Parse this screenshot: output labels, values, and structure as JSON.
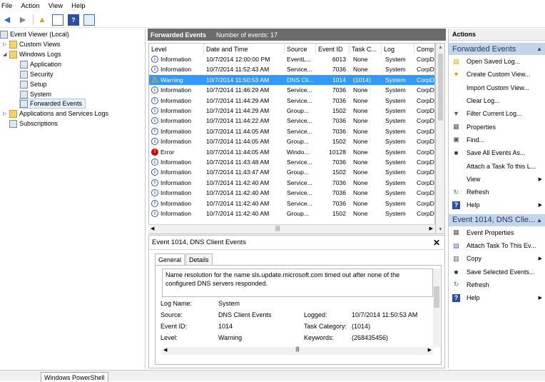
{
  "menu": [
    "File",
    "Action",
    "View",
    "Help"
  ],
  "toolbar": {
    "icons": [
      "back-arrow-icon",
      "forward-arrow-icon",
      "show-hide-tree-icon",
      "up-folder-icon",
      "properties-icon",
      "help-icon",
      "show-hide-action-icon"
    ]
  },
  "tree": {
    "root": "Event Viewer (Local)",
    "custom_views": "Custom Views",
    "windows_logs": "Windows Logs",
    "application": "Application",
    "security": "Security",
    "setup": "Setup",
    "system": "System",
    "forwarded_events": "Forwarded Events",
    "app_services": "Applications and Services Logs",
    "subscriptions": "Subscriptions"
  },
  "center": {
    "title": "Forwarded Events",
    "count": "Number of events: 17",
    "columns": [
      "Level",
      "Date and Time",
      "Source",
      "Event ID",
      "Task C...",
      "Log",
      "Comp"
    ],
    "rows": [
      {
        "level": "Information",
        "date": "10/7/2014 12:00:00 PM",
        "source": "EventL...",
        "id": "6013",
        "task": "None",
        "log": "System",
        "comp": "CorpD"
      },
      {
        "level": "Information",
        "date": "10/7/2014 11:52:43 AM",
        "source": "Service...",
        "id": "7036",
        "task": "None",
        "log": "System",
        "comp": "CorpD"
      },
      {
        "level": "Warning",
        "date": "10/7/2014 11:50:53 AM",
        "source": "DNS Cli...",
        "id": "1014",
        "task": "(1014)",
        "log": "System",
        "comp": "CorpD"
      },
      {
        "level": "Information",
        "date": "10/7/2014 11:46:29 AM",
        "source": "Service...",
        "id": "7036",
        "task": "None",
        "log": "System",
        "comp": "CorpD"
      },
      {
        "level": "Information",
        "date": "10/7/2014 11:44:29 AM",
        "source": "Service...",
        "id": "7036",
        "task": "None",
        "log": "System",
        "comp": "CorpD"
      },
      {
        "level": "Information",
        "date": "10/7/2014 11:44:29 AM",
        "source": "Group...",
        "id": "1502",
        "task": "None",
        "log": "System",
        "comp": "CorpD"
      },
      {
        "level": "Information",
        "date": "10/7/2014 11:44:22 AM",
        "source": "Service...",
        "id": "7036",
        "task": "None",
        "log": "System",
        "comp": "CorpD"
      },
      {
        "level": "Information",
        "date": "10/7/2014 11:44:05 AM",
        "source": "Service...",
        "id": "7036",
        "task": "None",
        "log": "System",
        "comp": "CorpD"
      },
      {
        "level": "Information",
        "date": "10/7/2014 11:44:05 AM",
        "source": "Group...",
        "id": "1502",
        "task": "None",
        "log": "System",
        "comp": "CorpD"
      },
      {
        "level": "Error",
        "date": "10/7/2014 11:44:05 AM",
        "source": "Windo...",
        "id": "10128",
        "task": "None",
        "log": "System",
        "comp": "CorpD"
      },
      {
        "level": "Information",
        "date": "10/7/2014 11:43:48 AM",
        "source": "Service...",
        "id": "7036",
        "task": "None",
        "log": "System",
        "comp": "CorpD"
      },
      {
        "level": "Information",
        "date": "10/7/2014 11:43:47 AM",
        "source": "Group...",
        "id": "1502",
        "task": "None",
        "log": "System",
        "comp": "CorpD"
      },
      {
        "level": "Information",
        "date": "10/7/2014 11:42:40 AM",
        "source": "Service...",
        "id": "7036",
        "task": "None",
        "log": "System",
        "comp": "CorpD"
      },
      {
        "level": "Information",
        "date": "10/7/2014 11:42:40 AM",
        "source": "Service...",
        "id": "7036",
        "task": "None",
        "log": "System",
        "comp": "CorpD"
      },
      {
        "level": "Information",
        "date": "10/7/2014 11:42:40 AM",
        "source": "Service...",
        "id": "7036",
        "task": "None",
        "log": "System",
        "comp": "CorpD"
      },
      {
        "level": "Information",
        "date": "10/7/2014 11:42:40 AM",
        "source": "Group...",
        "id": "1502",
        "task": "None",
        "log": "System",
        "comp": "CorpD"
      }
    ]
  },
  "detail": {
    "title": "Event 1014, DNS Client Events",
    "tabs": [
      "General",
      "Details"
    ],
    "message": "Name resolution for the name sls.update.microsoft.com timed out after none of the configured DNS servers responded.",
    "log_name_label": "Log Name:",
    "log_name": "System",
    "source_label": "Source:",
    "source": "DNS Client Events",
    "logged_label": "Logged:",
    "logged": "10/7/2014 11:50:53 AM",
    "event_id_label": "Event ID:",
    "event_id": "1014",
    "task_cat_label": "Task Category:",
    "task_cat": "(1014)",
    "level_label": "Level:",
    "level": "Warning",
    "keywords_label": "Keywords:",
    "keywords": "(268435456)"
  },
  "actions": {
    "title": "Actions",
    "section1": "Forwarded Events",
    "items1": [
      {
        "label": "Open Saved Log...",
        "icon": "folder-open-icon",
        "sub": false
      },
      {
        "label": "Create Custom View...",
        "icon": "filter-create-icon",
        "sub": false
      },
      {
        "label": "Import Custom View...",
        "icon": "none",
        "sub": false
      },
      {
        "label": "Clear Log...",
        "icon": "none",
        "sub": false
      },
      {
        "label": "Filter Current Log...",
        "icon": "filter-icon",
        "sub": false
      },
      {
        "label": "Properties",
        "icon": "properties-icon",
        "sub": false
      },
      {
        "label": "Find...",
        "icon": "find-icon",
        "sub": false
      },
      {
        "label": "Save All Events As...",
        "icon": "save-icon",
        "sub": false
      },
      {
        "label": "Attach a Task To this L...",
        "icon": "none",
        "sub": false
      },
      {
        "label": "View",
        "icon": "none",
        "sub": true
      },
      {
        "label": "Refresh",
        "icon": "refresh-icon",
        "sub": false
      },
      {
        "label": "Help",
        "icon": "help-icon",
        "sub": true
      }
    ],
    "section2": "Event 1014, DNS Clie...",
    "items2": [
      {
        "label": "Event Properties",
        "icon": "properties-icon",
        "sub": false
      },
      {
        "label": "Attach Task To This Ev...",
        "icon": "task-icon",
        "sub": false
      },
      {
        "label": "Copy",
        "icon": "copy-icon",
        "sub": true
      },
      {
        "label": "Save Selected Events...",
        "icon": "save-icon",
        "sub": false
      },
      {
        "label": "Refresh",
        "icon": "refresh-icon",
        "sub": false
      },
      {
        "label": "Help",
        "icon": "help-icon",
        "sub": true
      }
    ]
  },
  "taskbar": {
    "item": "Windows PowerShell"
  },
  "colors": {
    "selection": "#3399ff",
    "section_header": "#c5d5e8",
    "panel_header": "#6c6c6c"
  }
}
